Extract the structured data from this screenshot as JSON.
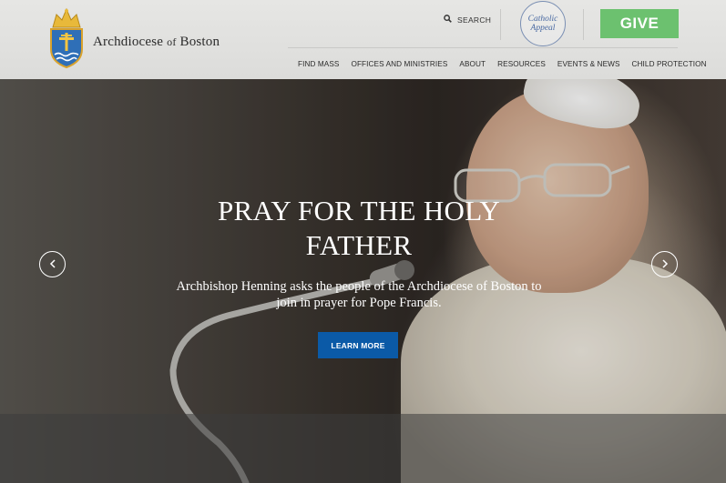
{
  "header": {
    "logo": {
      "text_main": "Archdiocese",
      "text_of": "of",
      "text_end": "Boston"
    },
    "search_label": "SEARCH",
    "appeal_line1": "Catholic",
    "appeal_line2": "Appeal",
    "give_label": "GIVE",
    "nav": [
      {
        "label": "FIND MASS"
      },
      {
        "label": "OFFICES AND MINISTRIES"
      },
      {
        "label": "ABOUT"
      },
      {
        "label": "RESOURCES"
      },
      {
        "label": "EVENTS & NEWS"
      },
      {
        "label": "CHILD PROTECTION"
      }
    ]
  },
  "hero": {
    "title_line1": "PRAY FOR THE HOLY",
    "title_line2": "FATHER",
    "subtitle_line1": "Archbishop Henning asks the people of the Archdiocese of Boston to",
    "subtitle_line2": "join in prayer for Pope Francis.",
    "cta_label": "LEARN MORE"
  },
  "icons": {
    "search": "search-icon",
    "prev": "chevron-left-icon",
    "next": "chevron-right-icon",
    "crest": "crest-icon"
  },
  "colors": {
    "give": "#6cc16f",
    "cta": "#0b5aa7",
    "appeal": "#4a6aa3"
  }
}
